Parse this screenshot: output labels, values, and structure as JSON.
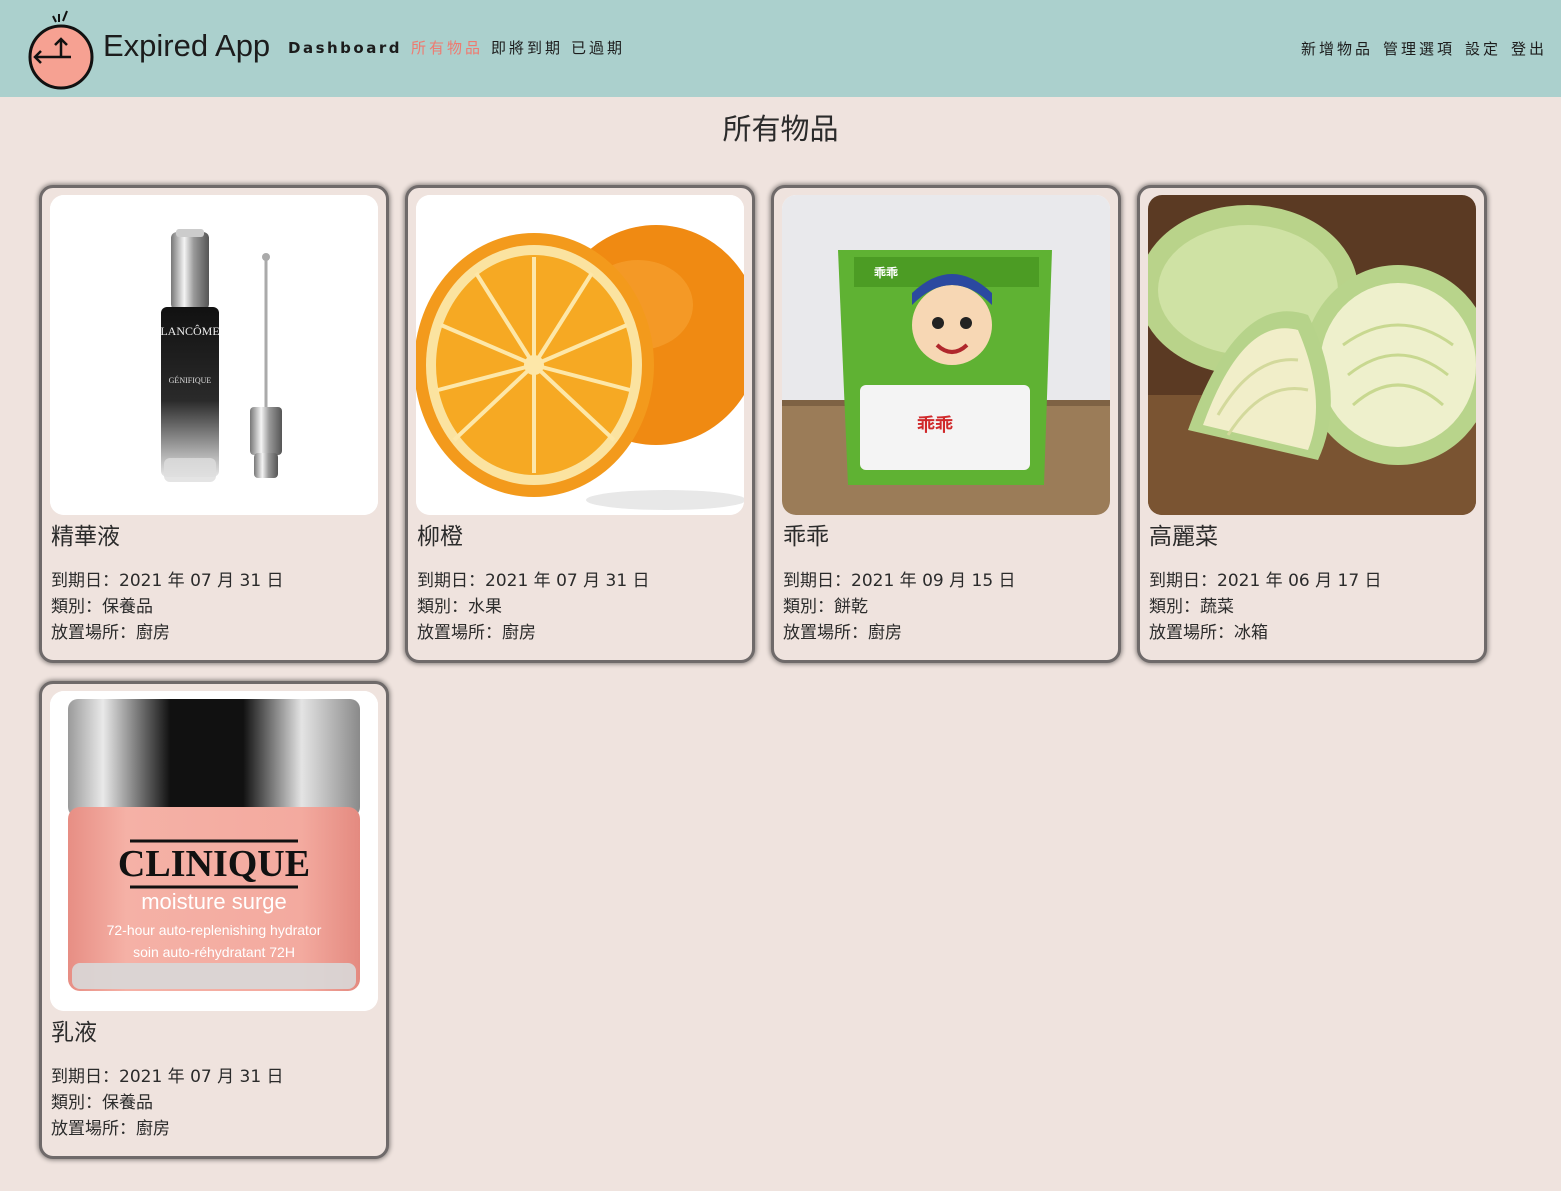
{
  "navbar": {
    "brand": "Expired App",
    "left_links": [
      {
        "label": "Dashboard",
        "active": false
      },
      {
        "label": "所有物品",
        "active": true
      },
      {
        "label": "即將到期",
        "active": false
      },
      {
        "label": "已過期",
        "active": false
      }
    ],
    "right_links": [
      {
        "label": "新增物品"
      },
      {
        "label": "管理選項"
      },
      {
        "label": "設定"
      },
      {
        "label": "登出"
      }
    ]
  },
  "page": {
    "title": "所有物品"
  },
  "items": [
    {
      "name": "精華液",
      "expiry": "到期日：2021 年 07 月 31 日",
      "category": "類別：保養品",
      "location": "放置場所：廚房",
      "image_icon": "serum-bottle-image"
    },
    {
      "name": "柳橙",
      "expiry": "到期日：2021 年 07 月 31 日",
      "category": "類別：水果",
      "location": "放置場所：廚房",
      "image_icon": "orange-image"
    },
    {
      "name": "乖乖",
      "expiry": "到期日：2021 年 09 月 15 日",
      "category": "類別：餅乾",
      "location": "放置場所：廚房",
      "image_icon": "snack-bag-image",
      "image_text": "乖乖"
    },
    {
      "name": "高麗菜",
      "expiry": "到期日：2021 年 06 月 17 日",
      "category": "類別：蔬菜",
      "location": "放置場所：冰箱",
      "image_icon": "cabbage-image"
    },
    {
      "name": "乳液",
      "expiry": "到期日：2021 年 07 月 31 日",
      "category": "類別：保養品",
      "location": "放置場所：廚房",
      "image_icon": "lotion-jar-image",
      "image_text": [
        "CLINIQUE",
        "moisture surge",
        "72-hour auto-replenishing hydrator",
        "soin auto-réhydratant 72H"
      ]
    }
  ],
  "colors": {
    "navbar_bg": "#abd0cd",
    "page_bg": "#efe3de",
    "active_link": "#ef7a70",
    "logo_fill": "#f6a192"
  }
}
